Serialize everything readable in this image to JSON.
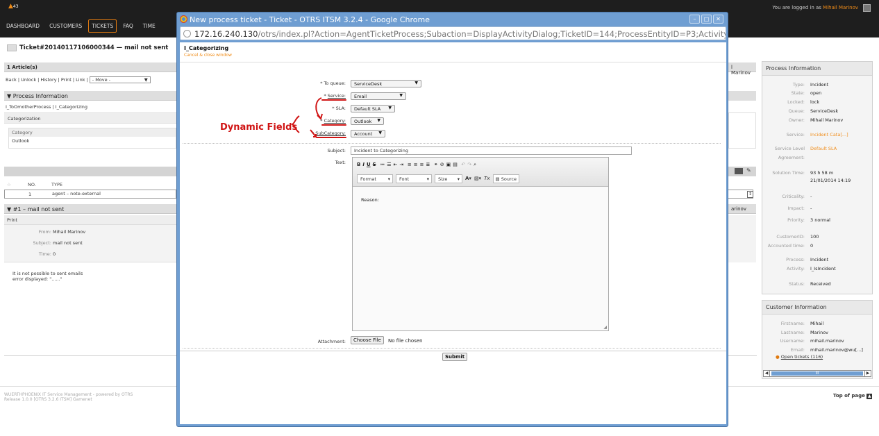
{
  "topbar": {
    "badge": "43",
    "nav": [
      "DASHBOARD",
      "CUSTOMERS",
      "TICKETS",
      "FAQ",
      "TIME"
    ],
    "logged_prefix": "You are logged in as",
    "user": "Mihail Marinov"
  },
  "ticket": {
    "title": "Ticket#20140117106000344 — mail not sent",
    "articles": "1 Article(s)",
    "actions": "Back | Unlock | History | Print | Link |",
    "move": "- Move -",
    "process_info": "Process Information",
    "process_path": "I_ToOmotherProcess | I_Categorizing",
    "categorization": "Categorization",
    "category_label": "Category",
    "category_value": "Outlook",
    "col_no": "NO.",
    "col_type": "TYPE",
    "row_no": "1",
    "row_type": "agent – note-external",
    "article_title": "#1 – mail not sent",
    "print": "Print",
    "from_label": "From:",
    "from_value": "Mihail Marinov",
    "subject_label": "Subject:",
    "subject_value": "mail not sent",
    "time_label": "Time:",
    "time_value": "0",
    "body1": "It is not possible to sent emails",
    "body2": "error displayed: \"......\"",
    "marinov1": "l Marinov",
    "marinov2": "arinov"
  },
  "footer": {
    "line1": "WUERTHPHOENIX IT Service Management - powered by OTRS",
    "line2": "Release 1.0.0 [OTRS 3.2.6 ITSM] Gamenet",
    "top": "Top of page"
  },
  "process_box": {
    "title": "Process Information",
    "rows": [
      {
        "k": "Type:",
        "v": "Incident"
      },
      {
        "k": "State:",
        "v": "open"
      },
      {
        "k": "Locked:",
        "v": "lock"
      },
      {
        "k": "Queue:",
        "v": "ServiceDesk"
      },
      {
        "k": "Owner:",
        "v": "Mihail Marinov"
      },
      {
        "k": "Service:",
        "v": "Incident Cata[...]"
      },
      {
        "k": "Service Level",
        "v": "Default SLA"
      },
      {
        "k": "Agreement:",
        "v": ""
      },
      {
        "k": "Solution Time:",
        "v": "93 h 58 m"
      },
      {
        "k": "",
        "v": "21/01/2014 14:19"
      },
      {
        "k": "Criticality:",
        "v": "-"
      },
      {
        "k": "Impact:",
        "v": "-"
      },
      {
        "k": "Priority:",
        "v": "3 normal"
      },
      {
        "k": "CustomerID:",
        "v": "100"
      },
      {
        "k": "Accounted time:",
        "v": "0"
      },
      {
        "k": "Process:",
        "v": "Incident"
      },
      {
        "k": "Activity:",
        "v": "I_IsIncident"
      },
      {
        "k": "Status:",
        "v": "Received"
      }
    ]
  },
  "customer_box": {
    "title": "Customer Information",
    "rows": [
      {
        "k": "Firstname:",
        "v": "Mihail"
      },
      {
        "k": "Lastname:",
        "v": "Marinov"
      },
      {
        "k": "Username:",
        "v": "mihail.marinov"
      },
      {
        "k": "Email:",
        "v": "mihail.marinov@wu[...]"
      }
    ],
    "open_tickets": "Open tickets (116)",
    "scroll_mid": "III"
  },
  "popup": {
    "window_title": "New process ticket - Ticket - OTRS ITSM 3.2.4 - Google Chrome",
    "url_host": "172.16.240.130",
    "url_rest": "/otrs/index.pl?Action=AgentTicketProcess;Subaction=DisplayActivityDialog;TicketID=144;ProcessEntityID=P3;ActivityDialogEntityID=",
    "heading": "I_Categorizing",
    "cancel": "Cancel & close window",
    "to_queue_label": "To queue:",
    "to_queue": "ServiceDesk",
    "service_label": "Service:",
    "service": "Email",
    "sla_label": "SLA:",
    "sla": "Default SLA",
    "category_label": "Category:",
    "category": "Outlook",
    "subcategory_label": "SubCategory:",
    "subcategory": "Account",
    "dynamic_fields": "Dynamic Fields",
    "subject_label": "Subject:",
    "subject": "Incident to Categorizing",
    "text_label": "Text:",
    "editor_text": "Reason:",
    "format": "Format",
    "font": "Font",
    "size": "Size",
    "source": "Source",
    "attachment_label": "Attachment:",
    "choose_file": "Choose File",
    "no_file": "No file chosen",
    "submit": "Submit"
  },
  "colors": {
    "accent": "#f08c18",
    "popup_frame": "#6f9ed2",
    "annotation": "#d01414"
  }
}
